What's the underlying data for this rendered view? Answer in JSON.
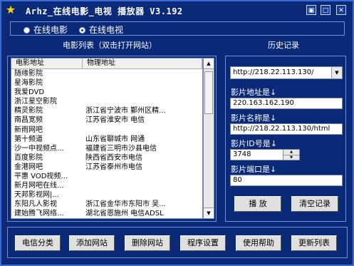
{
  "window": {
    "title": "Arhz_在线电影_电视 播放器 V3.192",
    "controls": {
      "minimize": "▣",
      "maximize": "□",
      "close": "✕"
    }
  },
  "mode": {
    "options": [
      {
        "label": "在线电影",
        "selected": false
      },
      {
        "label": "在线电视",
        "selected": true
      }
    ]
  },
  "list_section": {
    "caption": "电影列表（双击打开网站）"
  },
  "history_section": {
    "caption": "历史记录"
  },
  "table": {
    "columns": [
      "电影地址",
      "物理地址"
    ],
    "rows": [
      [
        "随缘影院",
        ""
      ],
      [
        "星海影院",
        ""
      ],
      [
        "我爱DVD",
        ""
      ],
      [
        "浙江星空影院",
        ""
      ],
      [
        "精灵影院",
        "浙江省宁波市 鄞州区精..."
      ],
      [
        "南昌宽频",
        "江苏省淮安市 电信"
      ],
      [
        "新雨网吧",
        ""
      ],
      [
        "第十频道",
        "山东省聊城市 网通"
      ],
      [
        "沙一中视频点...",
        "福建省三明市沙县电信"
      ],
      [
        "百度影院",
        "陕西省西安市电信"
      ],
      [
        "金港网吧",
        "江苏省泰州市电信"
      ],
      [
        "平惠 VOD视频...",
        ""
      ],
      [
        "新月网吧在线...",
        ""
      ],
      [
        "天邦影视网|...",
        ""
      ],
      [
        "东阳凡人影视",
        "浙江省金华市东阳市 吴..."
      ],
      [
        "建始腾飞网络...",
        "湖北省恩施州 电信ADSL"
      ]
    ]
  },
  "history": {
    "selected": "http://218.22.113.130/",
    "address_label": "影片地址是↓",
    "address_value": "220.163.162.190",
    "name_label": "影片名称是↓",
    "name_value": "http://218.22.113.130/html",
    "id_label": "影片ID号是↓",
    "id_value": "3748",
    "port_label": "影片端口是↓",
    "port_value": "80",
    "play_label": "播 放",
    "clear_label": "清空记录"
  },
  "toolbar": {
    "buttons": [
      "电信分类",
      "添加网站",
      "删除网站",
      "程序设置",
      "使用帮助",
      "更新列表"
    ]
  },
  "colors": {
    "background": "#0a2a78",
    "border": "#6f8fd8",
    "icon": "#ffd200"
  }
}
